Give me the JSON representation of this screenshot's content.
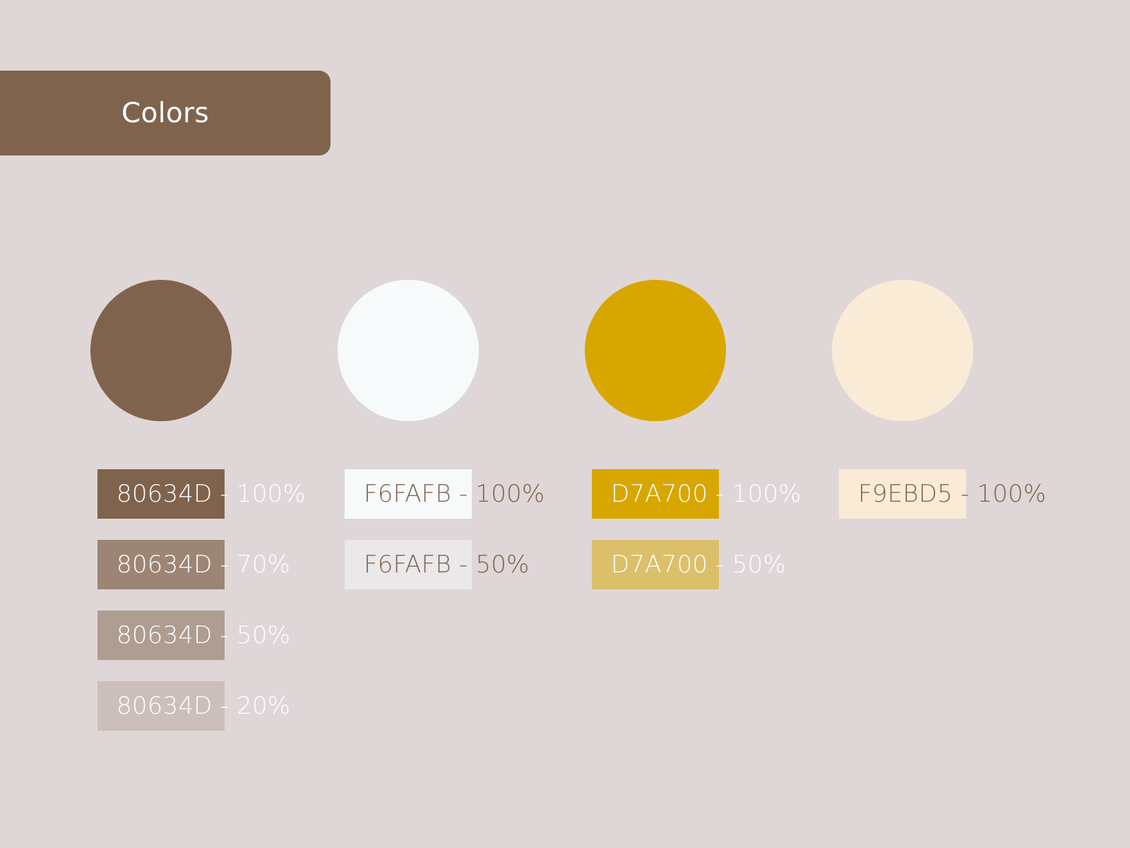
{
  "title": {
    "text": "Colors",
    "background": "#80634D",
    "text_color": "#FFFFFF"
  },
  "palette": [
    {
      "circle_color": "#80634D",
      "swatches": [
        {
          "label": "80634D - 100%",
          "color": "#80634D",
          "opacity": 1.0,
          "text_color": "#FFFFFF"
        },
        {
          "label": "80634D - 70%",
          "color": "#80634D",
          "opacity": 0.7,
          "text_color": "#FFFFFF"
        },
        {
          "label": "80634D - 50%",
          "color": "#80634D",
          "opacity": 0.5,
          "text_color": "#FFFFFF"
        },
        {
          "label": "80634D - 20%",
          "color": "#80634D",
          "opacity": 0.2,
          "text_color": "#FFFFFF"
        }
      ]
    },
    {
      "circle_color": "#F6FAFB",
      "swatches": [
        {
          "label": "F6FAFB - 100%",
          "color": "#F6FAFB",
          "opacity": 1.0,
          "text_color": "#80634D"
        },
        {
          "label": "F6FAFB - 50%",
          "color": "#F6FAFB",
          "opacity": 0.5,
          "text_color": "#80634D"
        }
      ]
    },
    {
      "circle_color": "#D7A700",
      "swatches": [
        {
          "label": "D7A700 - 100%",
          "color": "#D7A700",
          "opacity": 1.0,
          "text_color": "#FFFFFF"
        },
        {
          "label": "D7A700 - 50%",
          "color": "#D7A700",
          "opacity": 0.5,
          "text_color": "#FFFFFF"
        }
      ]
    },
    {
      "circle_color": "#F9EBD5",
      "swatches": [
        {
          "label": "F9EBD5 - 100%",
          "color": "#F9EBD5",
          "opacity": 1.0,
          "text_color": "#80634D"
        }
      ]
    }
  ]
}
